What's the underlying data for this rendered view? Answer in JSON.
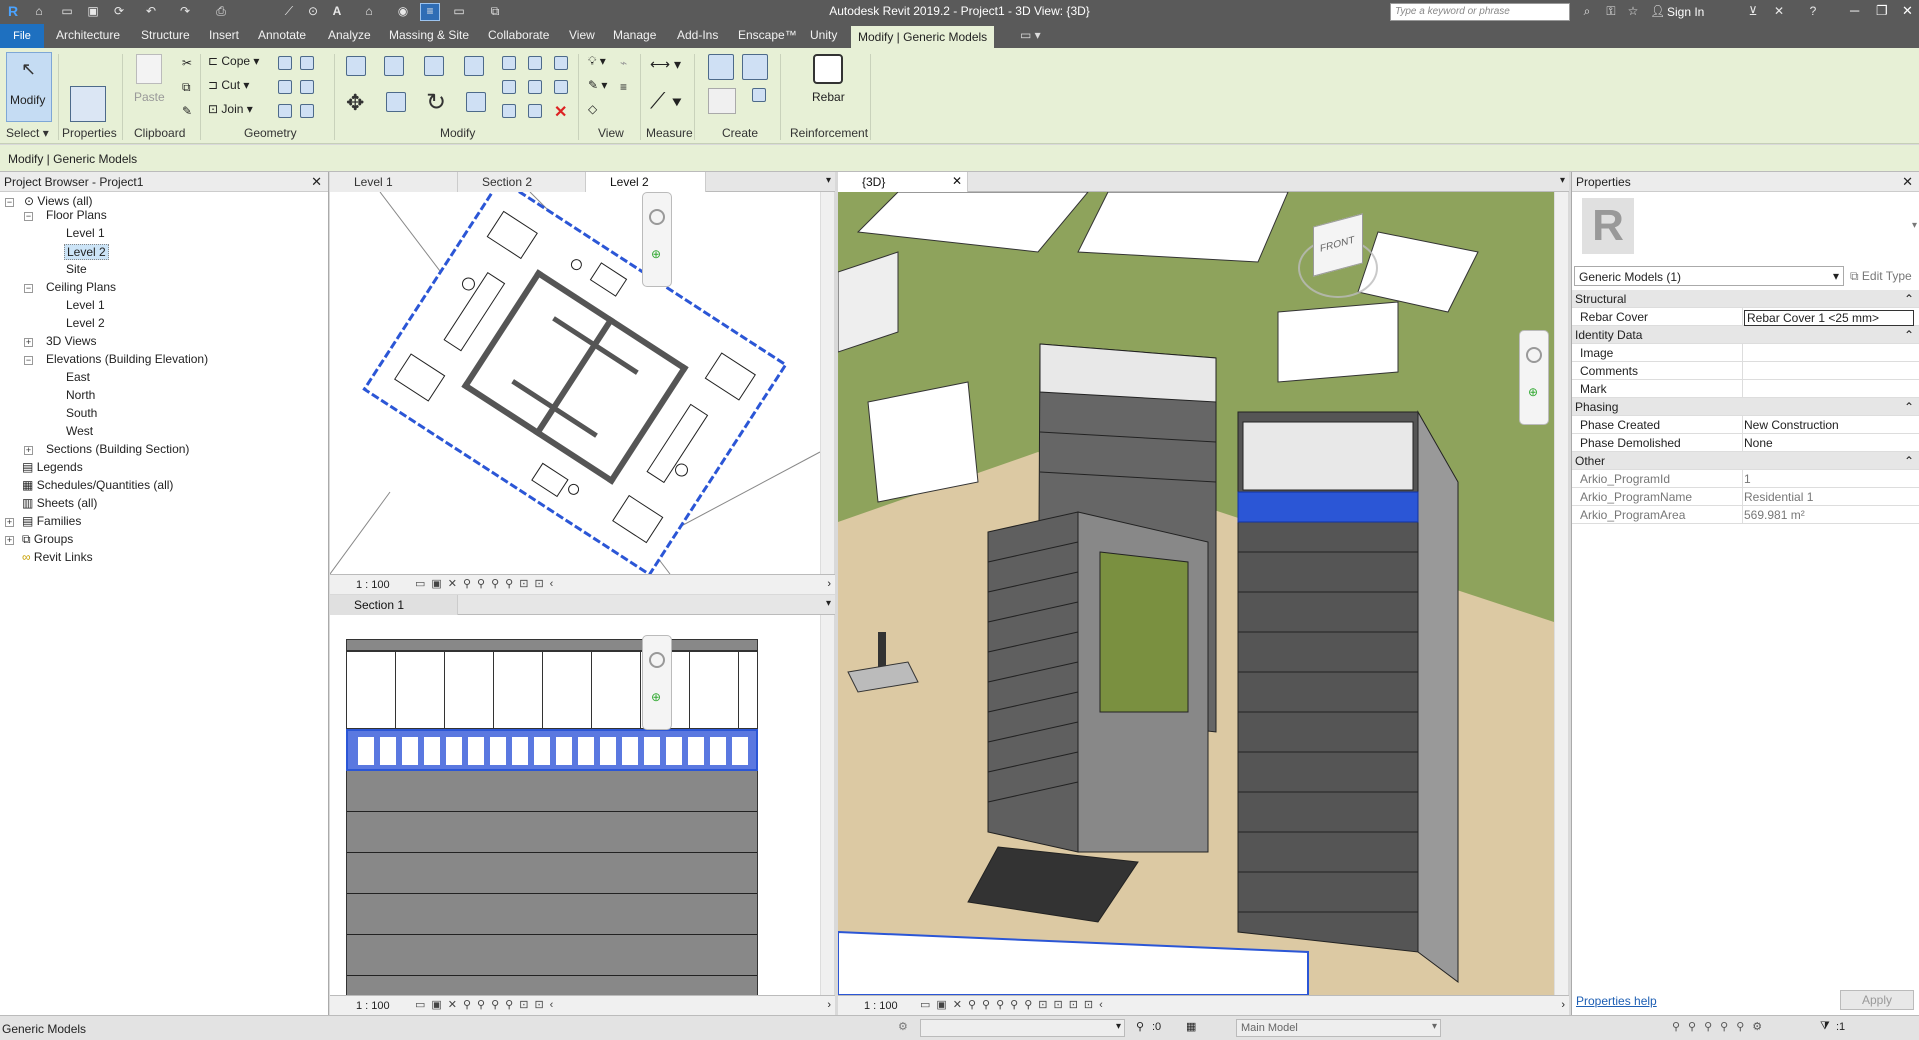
{
  "window": {
    "title": "Autodesk Revit 2019.2 - Project1 - 3D View: {3D}",
    "search_placeholder": "Type a keyword or phrase",
    "sign_in": "Sign In"
  },
  "ribbon_tabs": [
    "File",
    "Architecture",
    "Structure",
    "Insert",
    "Annotate",
    "Analyze",
    "Massing & Site",
    "Collaborate",
    "View",
    "Manage",
    "Add-Ins",
    "Enscape™",
    "Unity",
    "Modify | Generic Models"
  ],
  "ribbon": {
    "modify": "Modify",
    "select": "Select",
    "properties": "Properties",
    "paste": "Paste",
    "clipboard": "Clipboard",
    "cope": "Cope",
    "cut": "Cut",
    "join": "Join",
    "geometry": "Geometry",
    "modify_panel": "Modify",
    "view": "View",
    "measure": "Measure",
    "create": "Create",
    "rebar": "Rebar",
    "reinforcement": "Reinforcement"
  },
  "options_bar": "Modify | Generic Models",
  "browser": {
    "title": "Project Browser - Project1",
    "items": [
      "Views (all)",
      "Floor Plans",
      "Level 1",
      "Level 2",
      "Site",
      "Ceiling Plans",
      "Level 1",
      "Level 2",
      "3D Views",
      "Elevations (Building Elevation)",
      "East",
      "North",
      "South",
      "West",
      "Sections (Building Section)",
      "Legends",
      "Schedules/Quantities (all)",
      "Sheets (all)",
      "Families",
      "Groups",
      "Revit Links"
    ]
  },
  "view_tabs": {
    "top": [
      "Level 1",
      "Section 2",
      "Level 2"
    ],
    "bottom": "Section 1",
    "main": "{3D}"
  },
  "view_scale": "1 : 100",
  "viewcube": "FRONT",
  "properties": {
    "title": "Properties",
    "type_selector": "Generic Models (1)",
    "edit_type": "Edit Type",
    "sections": {
      "structural": "Structural",
      "identity": "Identity Data",
      "phasing": "Phasing",
      "other": "Other"
    },
    "rows": {
      "rebar_cover": [
        "Rebar Cover",
        "Rebar Cover 1 <25 mm>"
      ],
      "image": [
        "Image",
        ""
      ],
      "comments": [
        "Comments",
        ""
      ],
      "mark": [
        "Mark",
        ""
      ],
      "phase_created": [
        "Phase Created",
        "New Construction"
      ],
      "phase_demolished": [
        "Phase Demolished",
        "None"
      ],
      "program_id": [
        "Arkio_ProgramId",
        "1"
      ],
      "program_name": [
        "Arkio_ProgramName",
        "Residential 1"
      ],
      "program_area": [
        "Arkio_ProgramArea",
        "569.981 m²"
      ]
    },
    "help": "Properties help",
    "apply": "Apply"
  },
  "status": {
    "left": "Generic Models",
    "zero": ":0",
    "model": "Main Model",
    "filter": ":1"
  },
  "colors": {
    "accent": "#1e70c0",
    "ribbon_bg": "#e7f0d6",
    "titlebar": "#5a5a5a",
    "selection": "#2b56d6"
  }
}
